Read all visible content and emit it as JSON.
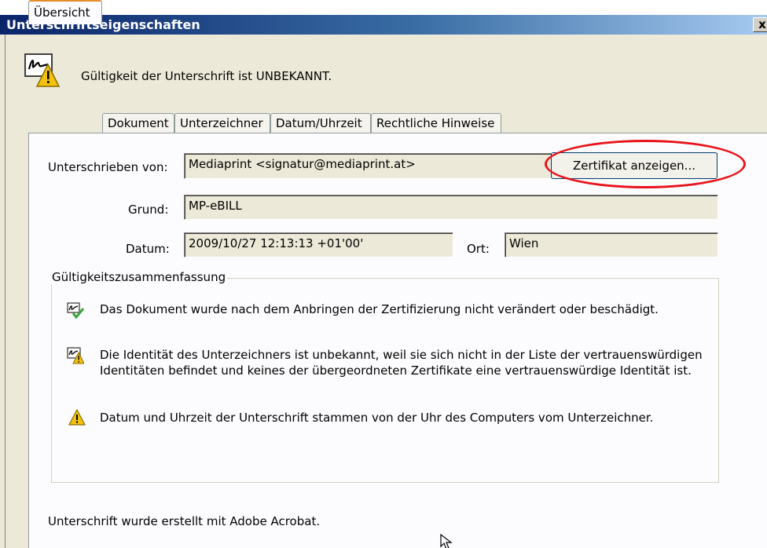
{
  "window": {
    "title": "Unterschriftseigenschaften",
    "close_label": "x"
  },
  "header": {
    "validity_message": "Gültigkeit der Unterschrift ist UNBEKANNT."
  },
  "tabs": [
    {
      "label": "Übersicht",
      "active": true
    },
    {
      "label": "Dokument",
      "active": false
    },
    {
      "label": "Unterzeichner",
      "active": false
    },
    {
      "label": "Datum/Uhrzeit",
      "active": false
    },
    {
      "label": "Rechtliche Hinweise",
      "active": false
    }
  ],
  "overview": {
    "signed_by_label": "Unterschrieben von:",
    "signed_by_value": "Mediaprint <signatur@mediaprint.at>",
    "show_certificate_label": "Zertifikat anzeigen...",
    "reason_label": "Grund:",
    "reason_value": "MP-eBILL",
    "date_label": "Datum:",
    "date_value": "2009/10/27 12:13:13 +01'00'",
    "location_label": "Ort:",
    "location_value": "Wien"
  },
  "validity_summary": {
    "title": "Gültigkeitszusammenfassung",
    "items": [
      {
        "icon": "signature-check-icon",
        "text": "Das Dokument wurde nach dem Anbringen der Zertifizierung nicht verändert oder beschädigt."
      },
      {
        "icon": "signature-warning-icon",
        "text_line1": "Die Identität des Unterzeichners ist unbekannt, weil sie sich nicht in der Liste der vertrauenswürdigen",
        "text_line2": "Identitäten befindet und keines der übergeordneten Zertifikate eine vertrauenswürdige Identität ist."
      },
      {
        "icon": "warning-triangle-icon",
        "text": "Datum und Uhrzeit der Unterschrift stammen von der Uhr des Computers vom Unterzeichner."
      }
    ]
  },
  "footer": {
    "created_with": "Unterschrift wurde erstellt mit Adobe Acrobat."
  },
  "colors": {
    "highlight_ring": "#e8131a",
    "active_tab_accent": "#e68b2c",
    "warning_yellow": "#f4c20d",
    "check_green": "#3aa63a"
  }
}
